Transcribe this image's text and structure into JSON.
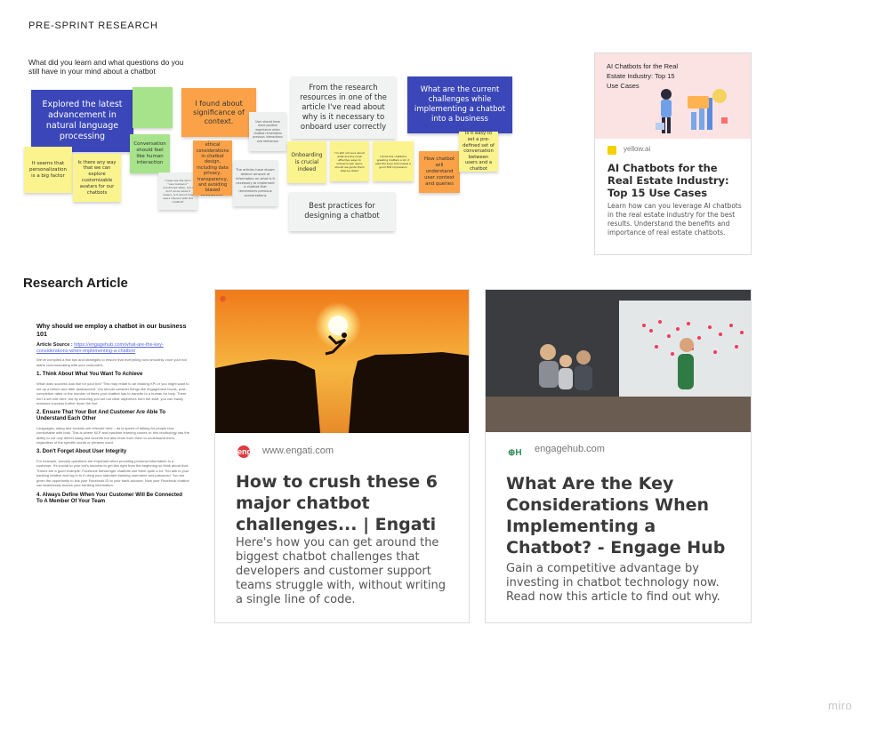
{
  "frame": {
    "title": "PRE-SPRINT RESEARCH",
    "prompt": "What did you learn and what questions do you still have in your mind about a chatbot"
  },
  "stickies": {
    "blue_1": "Explored the latest advancement in natural language processing",
    "blue_2": "What are the current challenges while implementing a chatbot into a business",
    "yellow_1": "It seems that personalization is a big factor",
    "yellow_2": "Is there any way that we can explore customizable avatars for our chatbots",
    "green_1": "Conversation should feel like human interaction",
    "orange_1": "I found about significance of context.",
    "orange_2": "Explored ethical considerations in chatbot design, including data privacy, transparency, and avoiding biased responses.",
    "orange_3": "How chatbot will understand user context and queries",
    "grey_1": "I keep see the term \"user behavior\" mentioned often, but I don't know what it means, is it about how users interact with the chatbot?",
    "grey_2": "User should have more positive experience when chatbot remembers previous interactions and references",
    "grey_3": "The articles have shown distinct amount of information on what is it necessary to implement a chatbot that remembers previous conversations",
    "pale_1": "From the research resources in one of the article I've read about why is it necessary to onboard user correctly",
    "pale_2": "Best practices for designing a chatbot",
    "yellow_onboarding": "Onboarding is crucial indeed",
    "yellow_small_1": "I'm still not sure about what are the most effective ways to onboard new users, should we guide them step by step?",
    "yellow_small_2": "I think the chatbot's greeting matters a lot, it sets the tone and makes a good first impression",
    "yellow_small_3": "Is it easy to set a pre-defined set of conversation between users and a chatbot"
  },
  "yellow_card": {
    "image_text": "AI Chatbots for the Real Estate Industry: Top 15 Use Cases",
    "domain": "yellow.ai",
    "title": "AI Chatbots for the Real Estate Industry: Top 15 Use Cases",
    "description": "Learn how can you leverage AI chatbots in the real estate industry for the best results. Understand the benefits and importance of real estate chatbots."
  },
  "section": {
    "title": "Research Article"
  },
  "document": {
    "title": "Why should we employ a chatbot in our business 101",
    "source_label": "Article Source : ",
    "source_link": "https://engagehub.com/what-are-the-key-considerations-when-implementing-a-chatbot/",
    "intro": "We've compiled a few tips and strategies to ensure that everything runs smoothly once your bot starts communicating with your customers.",
    "h1": "1. Think About What You Want To Achieve",
    "p1": "What does success look like for your bot? This may relate to an existing KPI or you might want to set up a before and after assessment. You should consider things like engagement levels, post-completion rates or the number of times your chatbot has to transfer to a human for help. There isn't a set rule here, but by ensuring you set out clear objectives from the start, you can easily measure success further down the line.",
    "h2": "2. Ensure That Your Bot And Customer Are Able To Understand Each Other",
    "p2": "Languages, slang and accents are relevant here – as is speed of talking for people less comfortable with bots. This is where NLP and machine learning comes in; this technology has the ability to not only detect slang and accents but also learn from them to understand them, regardless of the specific words or phrases used.",
    "h3": "3. Don't Forget About User Integrity",
    "p3": "For example, security questions are important when providing personal information to a customer. It's crucial to your bot's success to get this right from the beginning so think about that. Trivia's are a good example: Facebook Messenger chatbots use them quite a lot. You talk to your banking chatbot and log in to it using your standard banking username and password. You are given the opportunity to link your Facebook ID to your bank account. Now your Facebook chatbot can seamlessly access your banking information.",
    "h4": "4. Always Define When Your Customer Will Be Connected To A Member Of Your Team"
  },
  "engati_card": {
    "logo": "engati",
    "domain": "www.engati.com",
    "title": "How to crush these 6 major chatbot challenges... | Engati",
    "description": "Here's how you can get around the biggest chatbot challenges that developers and customer support teams struggle with, without writing a single line of code."
  },
  "engagehub_card": {
    "domain": "engagehub.com",
    "title": "What Are the Key Considerations When Implementing a Chatbot? - Engage Hub",
    "description": "Gain a competitive advantage by investing in chatbot technology now. Read now this article to find out why."
  },
  "branding": {
    "watermark": "miro"
  },
  "colors": {
    "blue_sticky": "#3b47b8",
    "yellow_sticky": "#fbf38e",
    "green_sticky": "#a7e38a",
    "orange_sticky": "#fba248",
    "link_blue": "#5b6be0"
  }
}
